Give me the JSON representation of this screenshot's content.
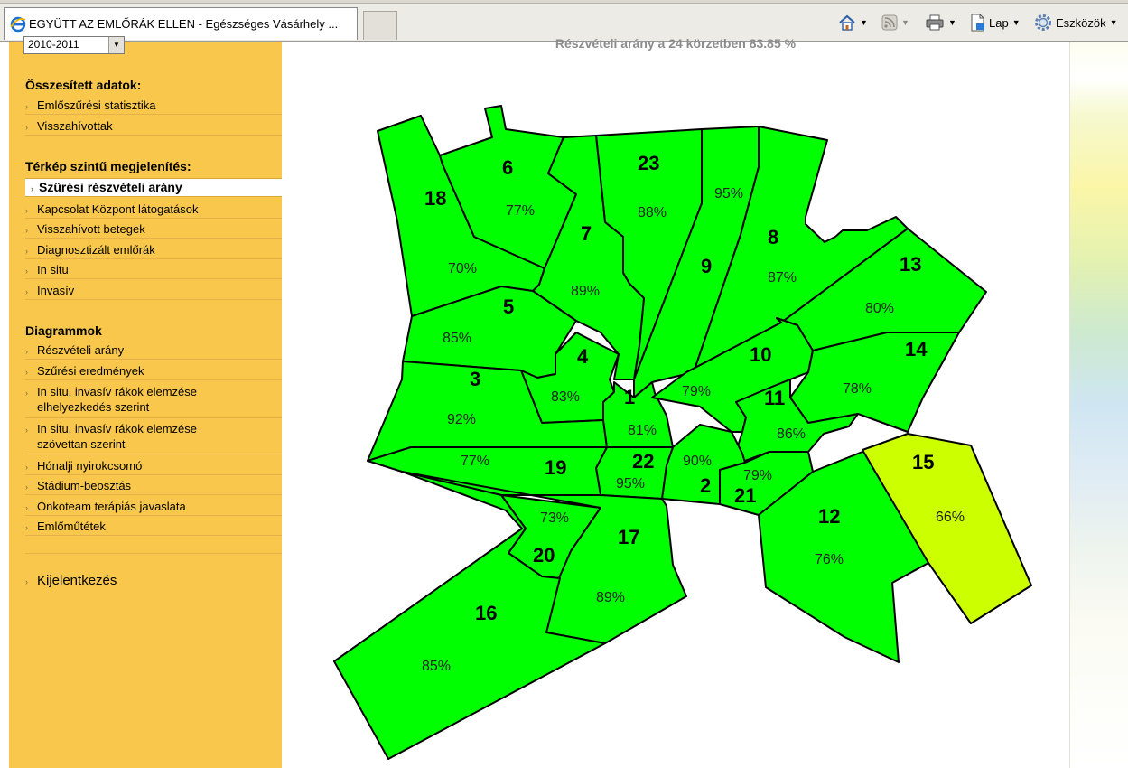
{
  "browser": {
    "tab_title": "EGYÜTT AZ EMLŐRÁK ELLEN - Egészséges Vásárhely ...",
    "toolbar": {
      "page_label": "Lap",
      "tools_label": "Eszközök"
    }
  },
  "sidebar": {
    "year_select_value": "2010-2011",
    "sections": [
      {
        "title": "Összesített adatok:",
        "items": [
          "Emlőszűrési statisztika",
          "Visszahívottak"
        ]
      },
      {
        "title": "Térkép szintű megjelenítés:",
        "items": [
          "Szűrési részvételi arány",
          "Kapcsolat Központ látogatások",
          "Visszahívott betegek",
          "Diagnosztizált emlőrák",
          "In situ",
          "Invasív"
        ]
      },
      {
        "title": "Diagrammok",
        "items": [
          "Részvételi arány",
          "Szűrési eredmények",
          "In situ, invasív rákok elemzése elhelyezkedés szerint",
          "In situ, invasív rákok elemzése szövettan szerint",
          "Hónalji nyirokcsomó",
          "Stádium-beosztás",
          "Onkoteam terápiás javaslata",
          "Emlőműtétek"
        ]
      }
    ],
    "active_item": "Szűrési részvételi arány",
    "logout_label": "Kijelentkezés"
  },
  "main": {
    "participation_text": "Részvételi arány a 24 körzetben 83.85 %"
  },
  "map": {
    "colors": {
      "default": "#00ff00",
      "low": "#ccff00",
      "stroke": "#000000"
    },
    "districts": [
      {
        "id": "1",
        "pct": "81%"
      },
      {
        "id": "2",
        "pct": "90%"
      },
      {
        "id": "3",
        "pct": "92%"
      },
      {
        "id": "4",
        "pct": "83%"
      },
      {
        "id": "5",
        "pct": "85%"
      },
      {
        "id": "6",
        "pct": "77%"
      },
      {
        "id": "7",
        "pct": "89%"
      },
      {
        "id": "8",
        "pct": "87%"
      },
      {
        "id": "9",
        "pct": "95%"
      },
      {
        "id": "10",
        "pct": "79%"
      },
      {
        "id": "11",
        "pct": "86%"
      },
      {
        "id": "12",
        "pct": "76%"
      },
      {
        "id": "13",
        "pct": "80%"
      },
      {
        "id": "14",
        "pct": "78%"
      },
      {
        "id": "15",
        "pct": "66%"
      },
      {
        "id": "16",
        "pct": "85%"
      },
      {
        "id": "17",
        "pct": "89%"
      },
      {
        "id": "18",
        "pct": "70%"
      },
      {
        "id": "19",
        "pct": "77%"
      },
      {
        "id": "20",
        "pct": "73%"
      },
      {
        "id": "21",
        "pct": "79%"
      },
      {
        "id": "22",
        "pct": "95%"
      },
      {
        "id": "23",
        "pct": "88%"
      }
    ]
  }
}
